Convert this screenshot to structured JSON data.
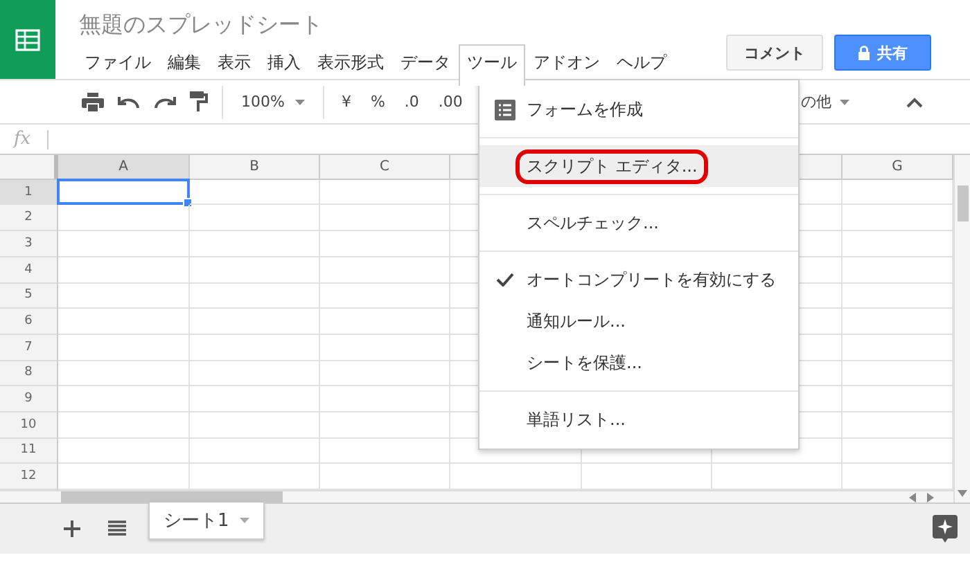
{
  "title": "無題のスプレッドシート",
  "menu_bar": [
    {
      "label": "ファイル",
      "selected": false
    },
    {
      "label": "編集",
      "selected": false
    },
    {
      "label": "表示",
      "selected": false
    },
    {
      "label": "挿入",
      "selected": false
    },
    {
      "label": "表示形式",
      "selected": false
    },
    {
      "label": "データ",
      "selected": false
    },
    {
      "label": "ツール",
      "selected": true
    },
    {
      "label": "アドオン",
      "selected": false
    },
    {
      "label": "ヘルプ",
      "selected": false
    }
  ],
  "buttons": [
    {
      "kind": "comment",
      "label": "コメント"
    },
    {
      "kind": "share",
      "label": "共有"
    }
  ],
  "toolbar": {
    "zoom": "100%",
    "currency": "¥",
    "percent": "%",
    "decrease_decimals": ".0",
    "increase_decimals": ".00",
    "more": "の他"
  },
  "formula_label": "fx",
  "columns": [
    {
      "label": "A",
      "selected": true
    },
    {
      "label": "B",
      "selected": false
    },
    {
      "label": "C",
      "selected": false
    },
    {
      "selected": false
    },
    {},
    {},
    {
      "label": "G",
      "selected": false
    }
  ],
  "rows": [
    {
      "label": "1",
      "selected": true
    },
    {
      "label": "2",
      "selected": false
    },
    {
      "label": "3",
      "selected": false
    },
    {
      "label": "4",
      "selected": false
    },
    {
      "label": "5",
      "selected": false
    },
    {
      "label": "6",
      "selected": false
    },
    {
      "label": "7",
      "selected": false
    },
    {
      "label": "8",
      "selected": false
    },
    {
      "label": "9",
      "selected": false
    },
    {
      "label": "10",
      "selected": false
    },
    {
      "label": "11",
      "selected": false
    },
    {
      "label": "12",
      "selected": false
    }
  ],
  "sheet_tabs": [
    {
      "label": "シート1",
      "selected": true
    }
  ],
  "tools_menu": [
    {
      "kind": "icon_item",
      "label": "フォームを作成",
      "checked": false,
      "highlighted": false,
      "outlined": false
    },
    {
      "kind": "divider"
    },
    {
      "kind": "item",
      "label": "スクリプト エディタ...",
      "checked": false,
      "highlighted": true,
      "outlined": true
    },
    {
      "kind": "divider"
    },
    {
      "kind": "item",
      "label": "スペルチェック...",
      "checked": false,
      "highlighted": false,
      "outlined": false
    },
    {
      "kind": "divider"
    },
    {
      "kind": "item",
      "label": "オートコンプリートを有効にする",
      "checked": true,
      "highlighted": false,
      "outlined": false
    },
    {
      "kind": "item",
      "label": "通知ルール...",
      "checked": false,
      "highlighted": false,
      "outlined": false
    },
    {
      "kind": "item",
      "label": "シートを保護...",
      "checked": false,
      "highlighted": false,
      "outlined": false
    },
    {
      "kind": "divider"
    },
    {
      "kind": "item",
      "label": "単語リスト...",
      "checked": false,
      "highlighted": false,
      "outlined": false
    }
  ]
}
